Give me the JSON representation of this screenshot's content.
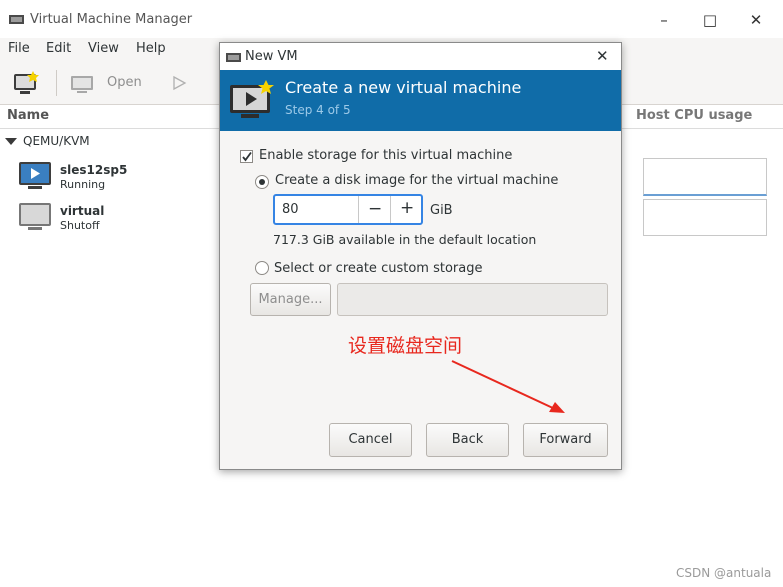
{
  "window": {
    "title": "Virtual Machine Manager",
    "controls": {
      "minimize": "–",
      "maximize": "□",
      "close": "✕"
    }
  },
  "menu": [
    "File",
    "Edit",
    "View",
    "Help"
  ],
  "toolbar": {
    "open_label": "Open"
  },
  "columns": {
    "name": "Name",
    "cpu": "Host CPU usage"
  },
  "connection": {
    "label": "QEMU/KVM"
  },
  "vms": [
    {
      "name": "sles12sp5",
      "status": "Running"
    },
    {
      "name": "virtual",
      "status": "Shutoff"
    }
  ],
  "dialog": {
    "title": "New VM",
    "header_title": "Create a new virtual machine",
    "step": "Step 4 of 5",
    "enable_storage": {
      "label": "Enable storage for this virtual machine",
      "checked": true
    },
    "create_disk": {
      "label": "Create a disk image for the virtual machine",
      "selected": true
    },
    "size": {
      "value": "80",
      "unit": "GiB",
      "minus": "−",
      "plus": "+"
    },
    "available": "717.3 GiB available in the default location",
    "custom_storage": {
      "label": "Select or create custom storage",
      "selected": false
    },
    "manage_label": "Manage...",
    "custom_path": "",
    "buttons": {
      "cancel": "Cancel",
      "back": "Back",
      "forward": "Forward"
    }
  },
  "annotation": {
    "text": "设置磁盘空间",
    "color": "#e8281e"
  },
  "watermark": "CSDN @antuala",
  "colors": {
    "header_bg": "#106ca8",
    "accent": "#3584e4"
  }
}
